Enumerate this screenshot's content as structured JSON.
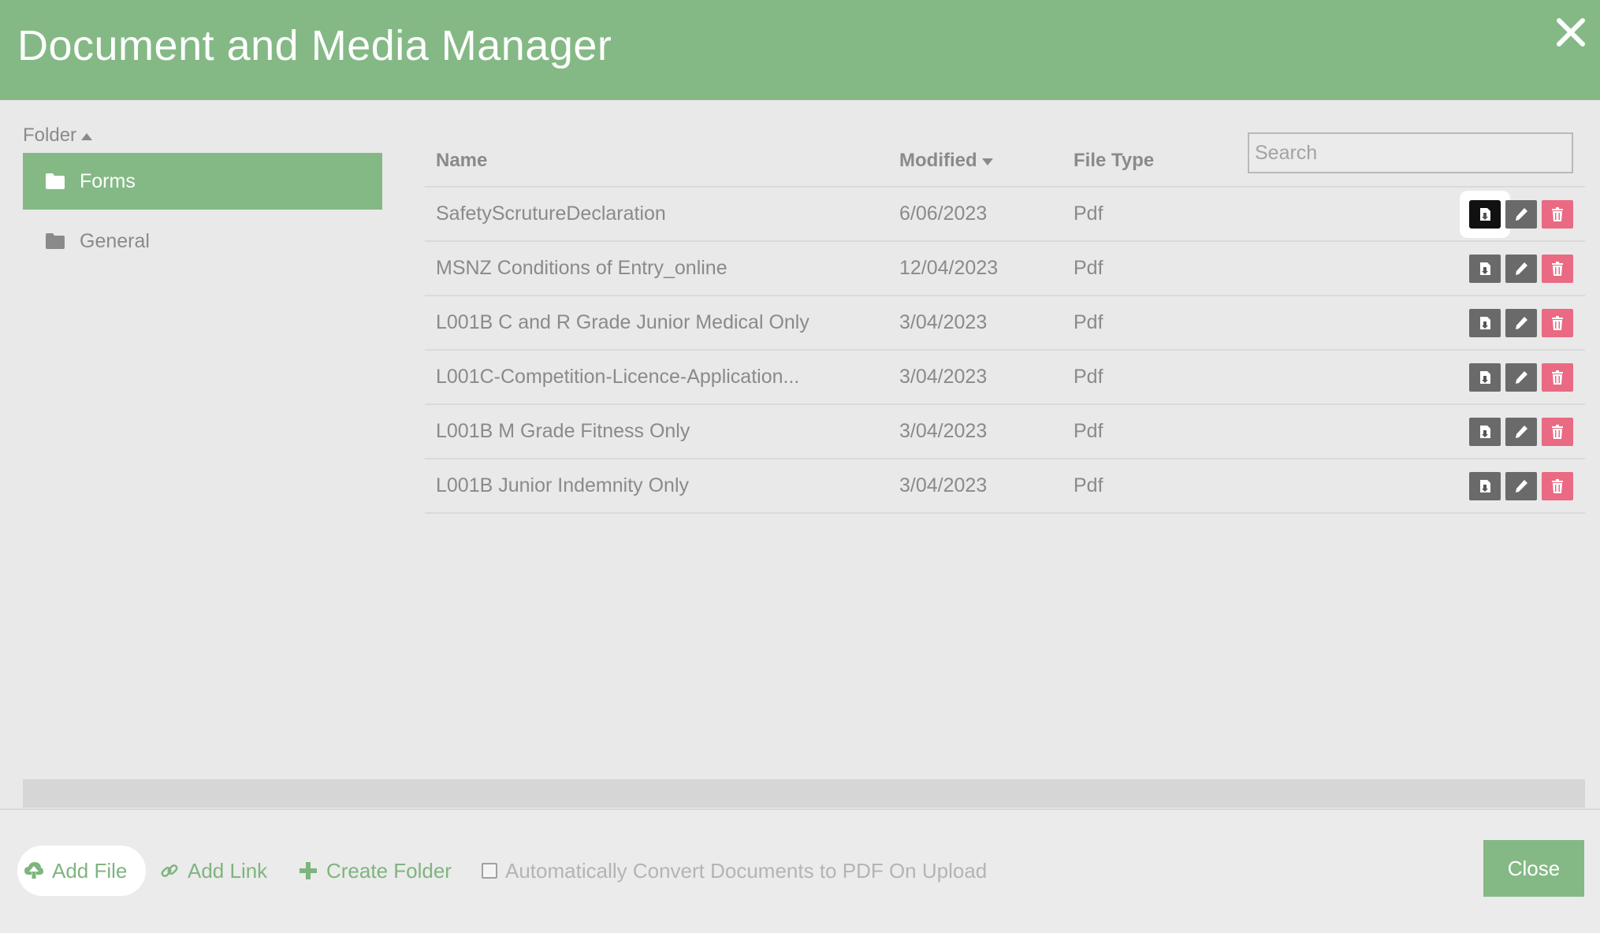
{
  "dialog": {
    "title": "Document and Media Manager",
    "close_icon": "close-x-icon",
    "accent_color": "#84b985",
    "danger_color": "#e96a82"
  },
  "folders": {
    "heading": "Folder",
    "sort": "ascending",
    "items": [
      {
        "label": "Forms",
        "icon": "folder-icon",
        "active": true
      },
      {
        "label": "General",
        "icon": "folder-icon",
        "active": false
      }
    ]
  },
  "search": {
    "placeholder": "Search",
    "value": ""
  },
  "table": {
    "columns": [
      {
        "label": "Name"
      },
      {
        "label": "Modified",
        "sort": "descending"
      },
      {
        "label": "File Type"
      }
    ],
    "rows": [
      {
        "name": "SafetyScrutureDeclaration",
        "modified": "6/06/2023",
        "type": "Pdf"
      },
      {
        "name": "MSNZ Conditions of Entry_online",
        "modified": "12/04/2023",
        "type": "Pdf"
      },
      {
        "name": "L001B C and R Grade Junior Medical Only",
        "modified": "3/04/2023",
        "type": "Pdf"
      },
      {
        "name": "L001C-Competition-Licence-Application...",
        "modified": "3/04/2023",
        "type": "Pdf"
      },
      {
        "name": "L001B M Grade Fitness Only",
        "modified": "3/04/2023",
        "type": "Pdf"
      },
      {
        "name": "L001B Junior Indemnity Only",
        "modified": "3/04/2023",
        "type": "Pdf"
      }
    ],
    "row_action_icons": [
      "download-icon",
      "pencil-icon",
      "trash-icon"
    ]
  },
  "footer": {
    "add_file": "Add File",
    "add_link": "Add Link",
    "create_folder": "Create Folder",
    "convert_label": "Automatically Convert Documents to PDF On Upload",
    "convert_checked": false,
    "close": "Close"
  }
}
